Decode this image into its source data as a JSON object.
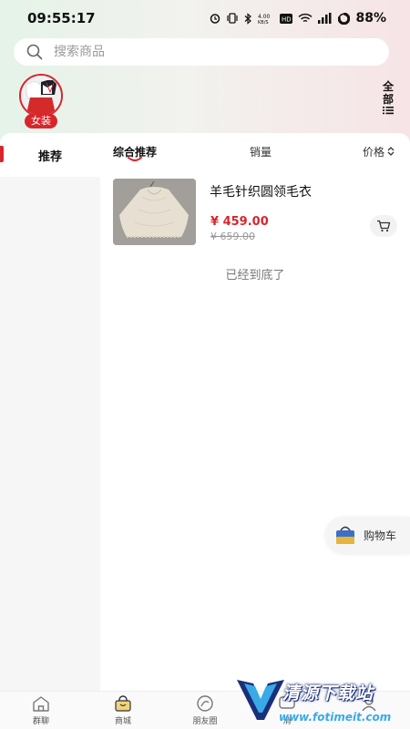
{
  "status_bar": {
    "time": "09:55:17",
    "net_speed": "4.00\nKB/S",
    "battery": "88%"
  },
  "search": {
    "placeholder": "搜索商品"
  },
  "category": {
    "badge": "女装",
    "all_label_1": "全",
    "all_label_2": "部"
  },
  "left_nav": {
    "items": [
      {
        "label": "推荐"
      }
    ]
  },
  "sort": {
    "comprehensive": "综合推荐",
    "sales": "销量",
    "price": "价格"
  },
  "products": [
    {
      "title": "羊毛针织圆领毛衣",
      "price": "¥ 459.00",
      "old_price": "¥ 659.00"
    }
  ],
  "list_end_text": "已经到底了",
  "float_cart": {
    "label": "购物车"
  },
  "tabs": [
    {
      "label": "群聊",
      "icon": "home-icon"
    },
    {
      "label": "商城",
      "icon": "shopping-bag-icon"
    },
    {
      "label": "朋友圈",
      "icon": "moments-icon"
    },
    {
      "label": "消",
      "icon": "message-icon"
    },
    {
      "label": "",
      "icon": "profile-icon"
    }
  ],
  "watermark": {
    "title": "清源下载站",
    "url": "www.fotimeit.com"
  },
  "colors": {
    "accent": "#d8262c",
    "price": "#d8262c",
    "tab_active": "#c59a2a"
  }
}
